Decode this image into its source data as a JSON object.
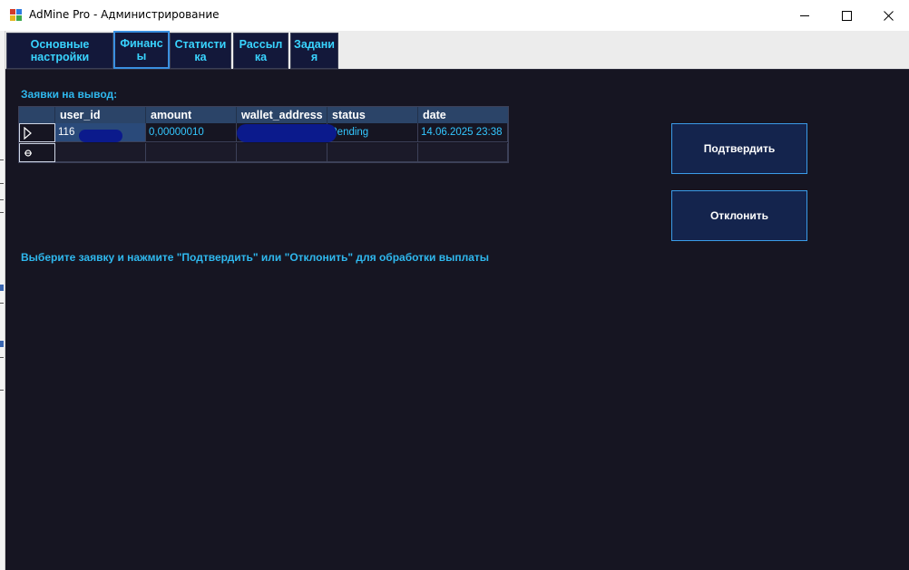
{
  "window": {
    "title": "AdMine Pro - Администрирование",
    "icon": "app-icon"
  },
  "tabs": [
    {
      "label": "Основные\nнастройки",
      "active": false
    },
    {
      "label": "Финанс\nы",
      "active": true
    },
    {
      "label": "Статисти\nка",
      "active": false
    },
    {
      "label": "Рассыл\nка",
      "active": false
    },
    {
      "label": "Задани\nя",
      "active": false
    }
  ],
  "withdrawals": {
    "label": "Заявки на вывод:",
    "columns": [
      "user_id",
      "amount",
      "wallet_address",
      "status",
      "date"
    ],
    "rows": [
      {
        "user_id": "116",
        "amount": "0,00000010",
        "wallet_address": "",
        "status": "Pending",
        "date": "14.06.2025 23:38"
      }
    ]
  },
  "buttons": {
    "confirm": "Подтвердить",
    "reject": "Отклонить"
  },
  "hint": "Выберите заявку и нажмите \"Подтвердить\" или \"Отклонить\" для обработки выплаты",
  "colors": {
    "panel_bg": "#161522",
    "accent": "#2fb8ee",
    "tab_bg": "#13183a",
    "button_bg": "#14244d",
    "header_bg": "#2b4468"
  }
}
